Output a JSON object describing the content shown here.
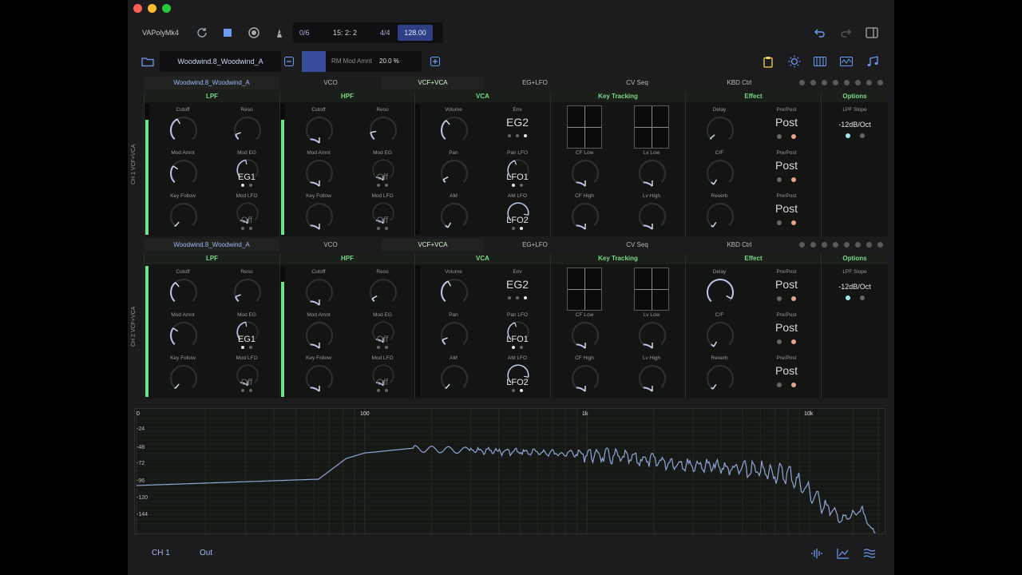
{
  "app": {
    "name": "VAPolyMk4"
  },
  "transport": {
    "voices": "0/6",
    "position": "15: 2: 2",
    "time_sig": "4/4",
    "tempo": "128.00"
  },
  "preset": {
    "name": "Woodwind.8_Woodwind_A",
    "param_name": "RM Mod Amnt",
    "param_value": "20.0 %"
  },
  "channels": [
    {
      "side_label": "CH 1 VCF+VCA",
      "tabs": [
        "Woodwind.8_Woodwind_A",
        "VCO",
        "VCF+VCA",
        "EG+LFO",
        "CV Seq",
        "KBD Ctrl"
      ],
      "sections": {
        "lpf": "LPF",
        "hpf": "HPF",
        "vca": "VCA",
        "key": "Key Tracking",
        "effect": "Effect",
        "options": "Options"
      },
      "lpf": {
        "cutoff": "Cutoff",
        "reso": "Reso",
        "mod_amnt": "Mod Amnt",
        "mod_eg": "Mod EG",
        "mod_eg_val": "EG1",
        "key_follow": "Key Follow",
        "mod_lfo": "Mod LFO",
        "mod_lfo_val": "Off"
      },
      "hpf": {
        "cutoff": "Cutoff",
        "reso": "Reso",
        "mod_amnt": "Mod Amnt",
        "mod_eg": "Mod EG",
        "mod_eg_val": "Off",
        "key_follow": "Key Follow",
        "mod_lfo": "Mod LFO",
        "mod_lfo_val": "Off"
      },
      "vca": {
        "volume": "Volume",
        "env": "Env",
        "env_val": "EG2",
        "pan": "Pan",
        "pan_lfo": "Pan LFO",
        "pan_lfo_val": "LFO1",
        "am": "AM",
        "am_lfo": "AM LFO",
        "am_lfo_val": "LFO2"
      },
      "key": {
        "cf_low": "CF Low",
        "lv_low": "Lv Low",
        "cf_high": "CF High",
        "lv_high": "Lv High"
      },
      "effect": {
        "delay": "Delay",
        "cf": "C/F",
        "reverb": "Reverb",
        "prepost": "Pre/Post",
        "post": "Post"
      },
      "options": {
        "lpf_slope": "LPF Slope",
        "slope_val": "-12dB/Oct"
      }
    },
    {
      "side_label": "CH 2 VCF+VCA",
      "tabs": [
        "Woodwind.8_Woodwind_A",
        "VCO",
        "VCF+VCA",
        "EG+LFO",
        "CV Seq",
        "KBD Ctrl"
      ],
      "sections": {
        "lpf": "LPF",
        "hpf": "HPF",
        "vca": "VCA",
        "key": "Key Tracking",
        "effect": "Effect",
        "options": "Options"
      },
      "lpf": {
        "cutoff": "Cutoff",
        "reso": "Reso",
        "mod_amnt": "Mod Amnt",
        "mod_eg": "Mod EG",
        "mod_eg_val": "EG1",
        "key_follow": "Key Follow",
        "mod_lfo": "Mod LFO",
        "mod_lfo_val": "Off"
      },
      "hpf": {
        "cutoff": "Cutoff",
        "reso": "Reso",
        "mod_amnt": "Mod Amnt",
        "mod_eg": "Mod EG",
        "mod_eg_val": "Off",
        "key_follow": "Key Follow",
        "mod_lfo": "Mod LFO",
        "mod_lfo_val": "Off"
      },
      "vca": {
        "volume": "Volume",
        "env": "Env",
        "env_val": "EG2",
        "pan": "Pan",
        "pan_lfo": "Pan LFO",
        "pan_lfo_val": "LFO1",
        "am": "AM",
        "am_lfo": "AM LFO",
        "am_lfo_val": "LFO2"
      },
      "key": {
        "cf_low": "CF Low",
        "lv_low": "Lv Low",
        "cf_high": "CF High",
        "lv_high": "Lv High"
      },
      "effect": {
        "delay": "Delay",
        "cf": "C/F",
        "reverb": "Reverb",
        "prepost": "Pre/Post",
        "post": "Post"
      },
      "options": {
        "lpf_slope": "LPF Slope",
        "slope_val": "-12dB/Oct"
      }
    }
  ],
  "spectrum": {
    "x_ticks": [
      "0",
      "100",
      "1k",
      "10k"
    ],
    "y_ticks": [
      "-24",
      "-48",
      "-72",
      "-96",
      "-120",
      "-144"
    ]
  },
  "bottom": {
    "channel": "CH 1",
    "output": "Out"
  },
  "colors": {
    "accent": "#4a63c8",
    "green": "#6ee28a",
    "curve": "#8fa6d6",
    "peach": "#e8a48a"
  }
}
